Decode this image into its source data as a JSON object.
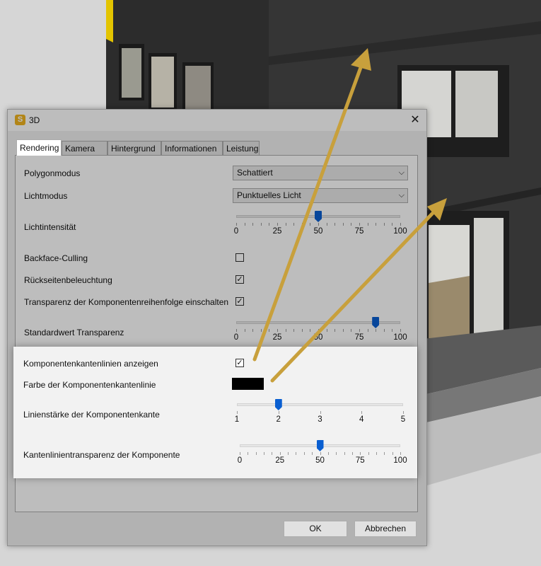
{
  "dialog": {
    "icon_letter": "S",
    "title": "3D",
    "close_glyph": "✕",
    "tabs": [
      "Rendering",
      "Kamera",
      "Hintergrund",
      "Informationen",
      "Leistung"
    ],
    "active_tab": "Rendering"
  },
  "rendering": {
    "polygon_mode": {
      "label": "Polygonmodus",
      "value": "Schattiert"
    },
    "light_mode": {
      "label": "Lichtmodus",
      "value": "Punktuelles Licht"
    },
    "light_intensity": {
      "label": "Lichtintensität",
      "value": 50,
      "ticks": [
        "0",
        "25",
        "50",
        "75",
        "100"
      ]
    },
    "backface_culling": {
      "label": "Backface-Culling",
      "checked": false
    },
    "backside_lighting": {
      "label": "Rückseitenbeleuchtung",
      "checked": true
    },
    "transparency_order": {
      "label": "Transparenz der Komponentenreihenfolge einschalten",
      "checked": true
    },
    "default_transparency": {
      "label": "Standardwert Transparenz",
      "value": 85,
      "ticks": [
        "0",
        "25",
        "50",
        "75",
        "100"
      ]
    },
    "show_edge_lines": {
      "label": "Komponentenkantenlinien anzeigen",
      "checked": true
    },
    "edge_line_color": {
      "label": "Farbe der Komponentenkantenlinie",
      "color": "#000000"
    },
    "edge_line_width": {
      "label": "Linienstärke der Komponentenkante",
      "value": 2,
      "ticks": [
        "1",
        "2",
        "3",
        "4",
        "5"
      ]
    },
    "edge_line_transparency": {
      "label": "Kantenlinientransparenz der Komponente",
      "value": 50,
      "ticks": [
        "0",
        "25",
        "50",
        "75",
        "100"
      ]
    }
  },
  "buttons": {
    "ok": "OK",
    "cancel": "Abbrechen"
  },
  "colors": {
    "slider_thumb": "#0a5fd1",
    "annotation_arrow": "#c8a03c",
    "app_icon": "#f0b420"
  }
}
